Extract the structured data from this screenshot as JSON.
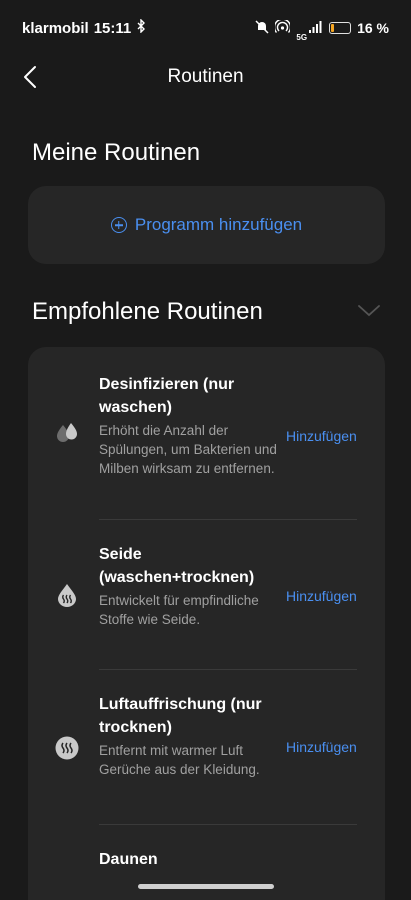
{
  "status_bar": {
    "carrier": "klarmobil",
    "time": "15:11",
    "network": "5G",
    "battery": "16 %"
  },
  "header": {
    "title": "Routinen"
  },
  "my_routines": {
    "title": "Meine Routinen",
    "add_label": "Programm hinzufügen"
  },
  "recommended": {
    "title": "Empfohlene Routinen",
    "add_label": "Hinzufügen",
    "items": [
      {
        "name": "Desinfizieren (nur waschen)",
        "desc": "Erhöht die Anzahl der Spülungen, um Bakterien und Milben wirksam zu entfernen.",
        "icon": "droplets-icon"
      },
      {
        "name": "Seide (waschen+trocknen)",
        "desc": "Entwickelt für empfindliche Stoffe wie Seide.",
        "icon": "steam-drop-icon"
      },
      {
        "name": "Luftauffrischung (nur trocknen)",
        "desc": "Entfernt mit warmer Luft Gerüche aus der Kleidung.",
        "icon": "steam-circle-icon"
      },
      {
        "name": "Daunen",
        "desc": "",
        "icon": ""
      }
    ]
  },
  "colors": {
    "accent": "#4a8ff0",
    "background": "#1a1a1a",
    "card": "#262626"
  }
}
